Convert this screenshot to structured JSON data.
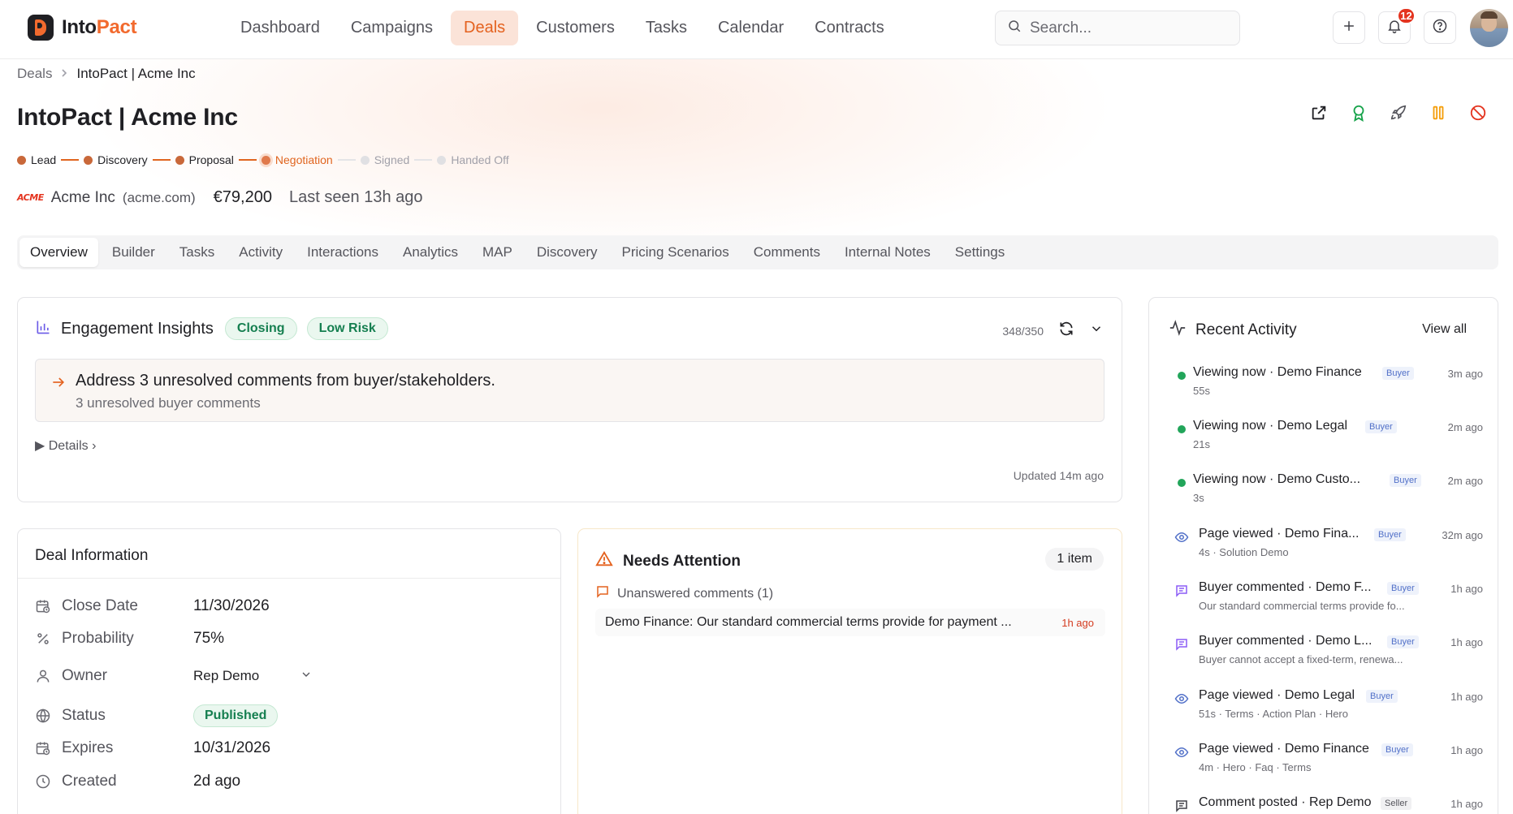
{
  "brand": {
    "name_part1": "Into",
    "name_part2": "Pact"
  },
  "nav": {
    "items": [
      {
        "label": "Dashboard",
        "active": false
      },
      {
        "label": "Campaigns",
        "active": false
      },
      {
        "label": "Deals",
        "active": true
      },
      {
        "label": "Customers",
        "active": false
      },
      {
        "label": "Tasks",
        "active": false
      },
      {
        "label": "Calendar",
        "active": false
      },
      {
        "label": "Contracts",
        "active": false
      }
    ],
    "search_placeholder": "Search...",
    "notification_count": "12"
  },
  "breadcrumb": {
    "parent": "Deals",
    "current": "IntoPact | Acme Inc"
  },
  "page": {
    "title": "IntoPact | Acme Inc"
  },
  "stages": [
    {
      "label": "Lead",
      "state": "done"
    },
    {
      "label": "Discovery",
      "state": "done"
    },
    {
      "label": "Proposal",
      "state": "done"
    },
    {
      "label": "Negotiation",
      "state": "current"
    },
    {
      "label": "Signed",
      "state": "future"
    },
    {
      "label": "Handed Off",
      "state": "future"
    }
  ],
  "company": {
    "logo_text": "ACME",
    "name": "Acme Inc",
    "domain": "(acme.com)",
    "value": "€79,200",
    "last_seen": "Last seen 13h ago"
  },
  "tabs": [
    {
      "label": "Overview",
      "active": true
    },
    {
      "label": "Builder"
    },
    {
      "label": "Tasks"
    },
    {
      "label": "Activity"
    },
    {
      "label": "Interactions"
    },
    {
      "label": "Analytics"
    },
    {
      "label": "MAP"
    },
    {
      "label": "Discovery"
    },
    {
      "label": "Pricing Scenarios"
    },
    {
      "label": "Comments"
    },
    {
      "label": "Internal Notes"
    },
    {
      "label": "Settings"
    }
  ],
  "engagement": {
    "title": "Engagement Insights",
    "pills": [
      "Closing",
      "Low Risk"
    ],
    "score": "348/350",
    "insight_title": "Address 3 unresolved comments from buyer/stakeholders.",
    "insight_sub": "3 unresolved buyer comments",
    "details_label": "▶ Details ›",
    "updated": "Updated 14m ago"
  },
  "deal_info": {
    "title": "Deal Information",
    "rows": [
      {
        "label": "Close Date",
        "value": "11/30/2026"
      },
      {
        "label": "Probability",
        "value": "75%"
      },
      {
        "label": "Owner",
        "value": "Rep Demo"
      },
      {
        "label": "Status",
        "value": "Published"
      },
      {
        "label": "Expires",
        "value": "10/31/2026"
      },
      {
        "label": "Created",
        "value": "2d ago"
      }
    ]
  },
  "attention": {
    "title": "Needs Attention",
    "count": "1 item",
    "sub": "Unanswered comments (1)",
    "item_text": "Demo Finance: Our standard commercial terms provide for payment ...",
    "item_time": "1h ago"
  },
  "activity": {
    "title": "Recent Activity",
    "view_all": "View all",
    "items": [
      {
        "kind": "live",
        "main": "Viewing now · Demo Finance",
        "tag": "Buyer",
        "time": "3m ago",
        "sub": "55s"
      },
      {
        "kind": "live",
        "main": "Viewing now · Demo Legal",
        "tag": "Buyer",
        "time": "2m ago",
        "sub": "21s"
      },
      {
        "kind": "live",
        "main": "Viewing now · Demo Custo...",
        "tag": "Buyer",
        "time": "2m ago",
        "sub": "3s"
      },
      {
        "kind": "view",
        "main": "Page viewed · Demo Fina...",
        "tag": "Buyer",
        "time": "32m ago",
        "sub": "4s · Solution Demo"
      },
      {
        "kind": "comment",
        "main": "Buyer commented · Demo F...",
        "tag": "Buyer",
        "time": "1h ago",
        "sub": "Our standard commercial terms provide fo..."
      },
      {
        "kind": "comment",
        "main": "Buyer commented · Demo L...",
        "tag": "Buyer",
        "time": "1h ago",
        "sub": "Buyer cannot accept a fixed-term, renewa..."
      },
      {
        "kind": "view",
        "main": "Page viewed · Demo Legal",
        "tag": "Buyer",
        "time": "1h ago",
        "sub": "51s · Terms · Action Plan · Hero"
      },
      {
        "kind": "view",
        "main": "Page viewed · Demo Finance",
        "tag": "Buyer",
        "time": "1h ago",
        "sub": "4m · Hero · Faq · Terms"
      },
      {
        "kind": "post",
        "main": "Comment posted · Rep Demo",
        "tag": "Seller",
        "time": "1h ago",
        "sub": ""
      }
    ]
  },
  "colors": {
    "accent": "#f26a2e",
    "success": "#157f50",
    "danger": "#e4341f",
    "buyer_tag": "#5170c8"
  }
}
